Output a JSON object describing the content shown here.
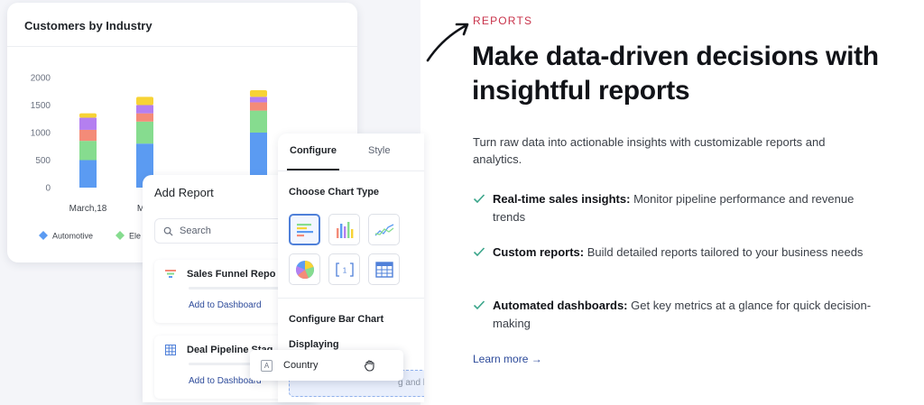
{
  "chart_card": {
    "title": "Customers by Industry",
    "legend": [
      "Automotive",
      "Ele"
    ]
  },
  "chart_data": {
    "type": "bar",
    "stacked": true,
    "categories": [
      "March,18",
      "Mar",
      "",
      ""
    ],
    "yticks": [
      2000,
      1500,
      1000,
      500,
      0
    ],
    "ylim": [
      0,
      2000
    ],
    "series": [
      {
        "name": "Automotive",
        "color": "#5b9bf2",
        "values": [
          500,
          800,
          0,
          1000
        ]
      },
      {
        "name": "Ele",
        "color": "#86dc8f",
        "values": [
          350,
          400,
          0,
          400
        ]
      },
      {
        "color": "#f48b78",
        "values": [
          200,
          150,
          0,
          150
        ]
      },
      {
        "color": "#b47ff0",
        "values": [
          220,
          150,
          0,
          100
        ]
      },
      {
        "color": "#f7d335",
        "values": [
          80,
          150,
          80,
          120
        ]
      }
    ],
    "grid": false,
    "legend_position": "bottom"
  },
  "add_report": {
    "title": "Add Report",
    "search_placeholder": "Search",
    "items": [
      {
        "label": "Sales Funnel Repo",
        "link": "Add to Dashboard"
      },
      {
        "label": "Deal Pipeline Stag",
        "link": "Add to Dashboard"
      }
    ]
  },
  "config_panel": {
    "tab_active": "Configure",
    "tab_inactive": "Style",
    "chart_type_heading": "Choose Chart Type",
    "bar_heading": "Configure Bar Chart",
    "displaying_label": "Displaying",
    "drop_hint": "g and he"
  },
  "drag_chip": {
    "icon_letter": "A",
    "label": "Country"
  },
  "content": {
    "eyebrow": "REPORTS",
    "headline": "Make data-driven decisions with insightful reports",
    "intro": "Turn raw data into actionable insights with customizable reports and analytics.",
    "features": [
      {
        "title": "Real-time sales insights:",
        "desc": "Monitor pipeline performance and revenue trends"
      },
      {
        "title": "Custom reports:",
        "desc": "Build detailed reports tailored to your business needs"
      },
      {
        "title": "Automated dashboards:",
        "desc": "Get key metrics at a glance for quick decision-making"
      }
    ],
    "learn_more": "Learn more →"
  },
  "colors": {
    "accent_red": "#c8324a",
    "link_blue": "#2c4a9a",
    "check_teal": "#3aa58a"
  }
}
